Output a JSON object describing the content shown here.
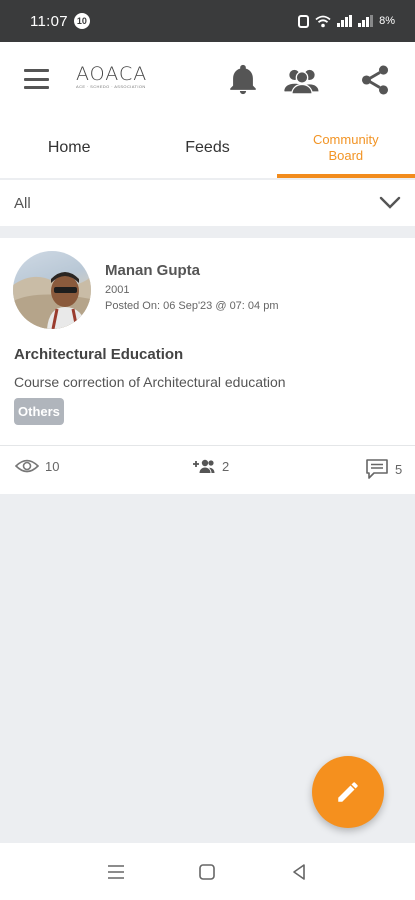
{
  "status_bar": {
    "time": "11:07",
    "notification_count": "10",
    "battery": "8%"
  },
  "header": {
    "logo_text": "AOACA",
    "logo_subtitle": "ACE · SCHEDO · ASSOCIATION",
    "icons": [
      "menu-icon",
      "bell-icon",
      "people-icon",
      "share-icon"
    ]
  },
  "tabs": [
    {
      "label": "Home",
      "active": false
    },
    {
      "label": "Feeds",
      "active": false
    },
    {
      "label": "Community Board",
      "active": true
    }
  ],
  "filter": {
    "selected": "All"
  },
  "post": {
    "author": "Manan Gupta",
    "year": "2001",
    "posted_on": "Posted On: 06 Sep'23 @ 07: 04 pm",
    "title": "Architectural Education",
    "description": "Course correction of Architectural education",
    "tag": "Others",
    "views": "10",
    "members": "2",
    "comments": "5"
  },
  "colors": {
    "accent": "#f29425",
    "status_bar": "#3a3b3c",
    "tag_bg": "#b0b5bc"
  }
}
